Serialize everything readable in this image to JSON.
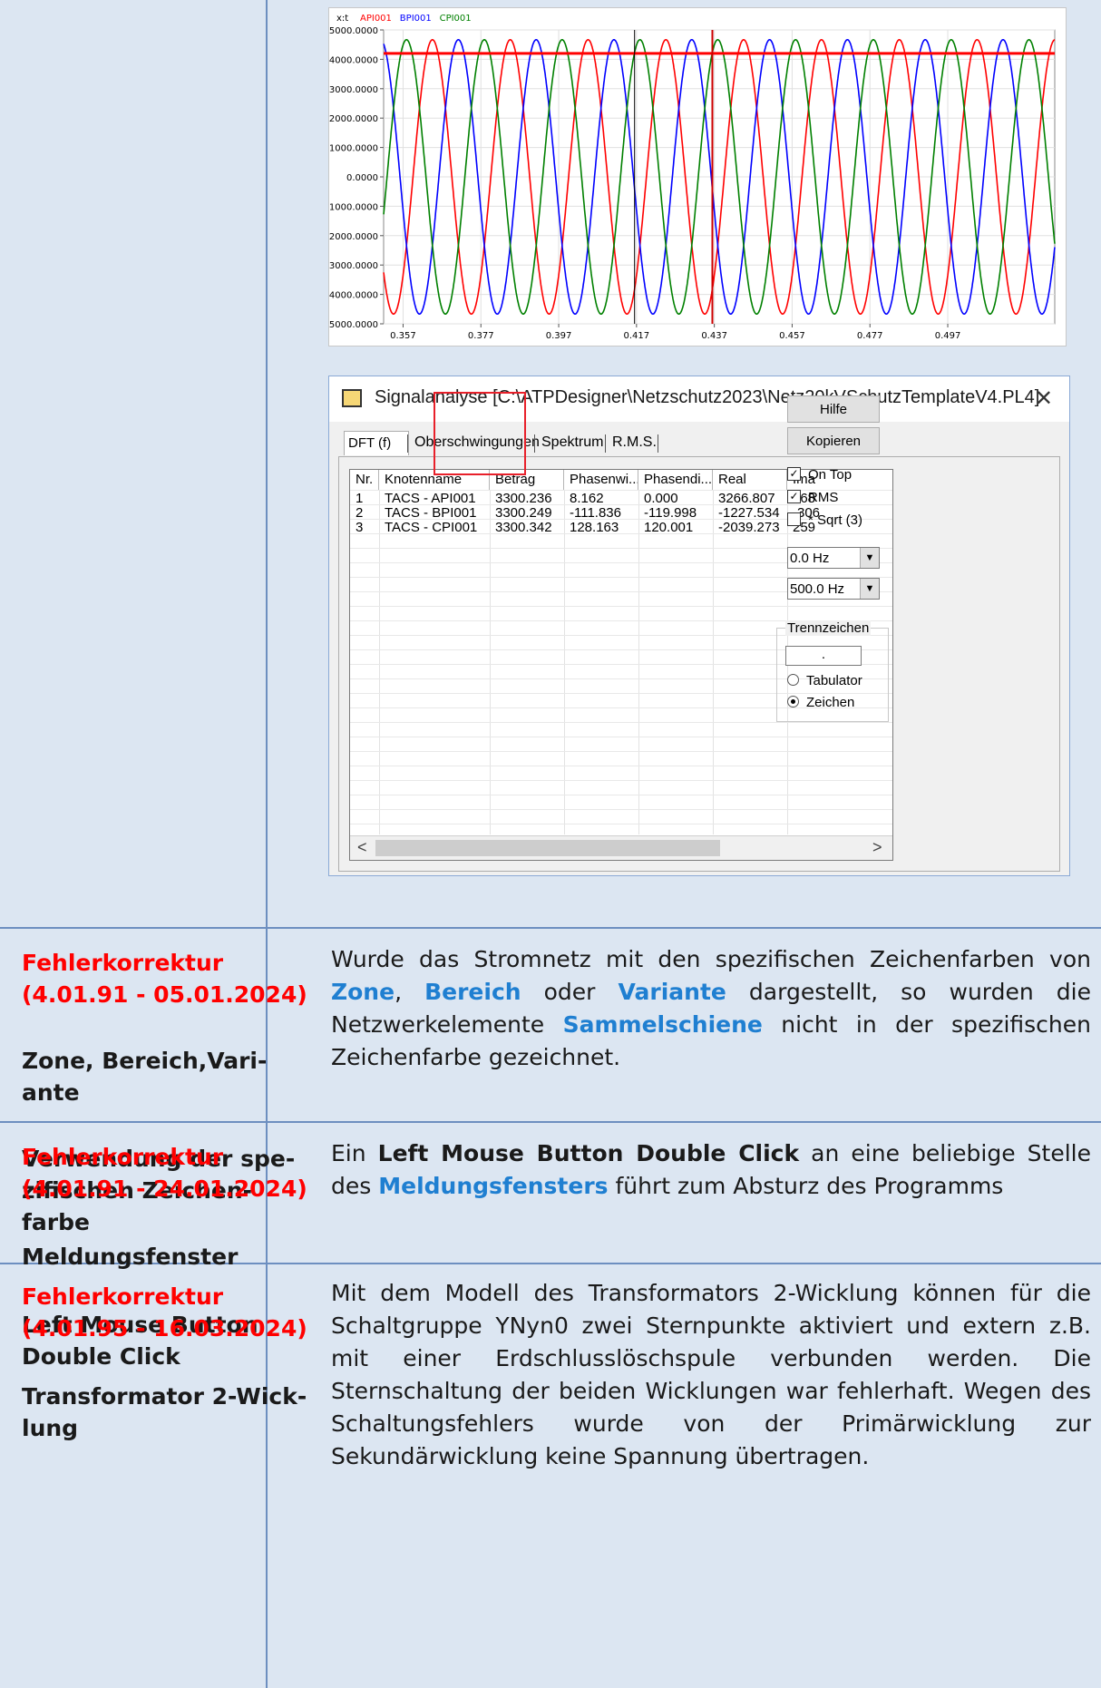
{
  "chart_data": {
    "type": "line",
    "legend_prefix": "x:t",
    "series": [
      {
        "name": "API001",
        "color": "#ff0000",
        "phase_deg": 8.162,
        "amplitude": 4667
      },
      {
        "name": "BPI001",
        "color": "#0000ff",
        "phase_deg": -111.836,
        "amplitude": 4667
      },
      {
        "name": "CPI001",
        "color": "#008000",
        "phase_deg": 128.163,
        "amplitude": 4667
      }
    ],
    "frequency_hz": 50,
    "x_ticks": [
      "0.357",
      "0.377",
      "0.397",
      "0.417",
      "0.437",
      "0.457",
      "0.477",
      "0.497"
    ],
    "y_ticks": [
      "5000.0000",
      "4000.0000",
      "3000.0000",
      "2000.0000",
      "1000.0000",
      "0.0000",
      "-1000.0000",
      "-2000.0000",
      "-3000.0000",
      "-4000.0000",
      "-5000.0000"
    ],
    "xlim": [
      0.352,
      0.5245
    ],
    "ylim": [
      -5000,
      5000
    ],
    "horizontal_marker_y": 4200,
    "cursor_x": [
      0.4165,
      0.4365
    ],
    "grid": true
  },
  "dialog": {
    "title": "Signalanalyse [C:\\ATPDesigner\\Netzschutz2023\\Netz20kVSchutzTemplateV4.PL4]",
    "close_label": "✕",
    "tabs": [
      "DFT (f)",
      "Oberschwingungen",
      "Spektrum",
      "R.M.S."
    ],
    "columns": [
      "Nr.",
      "Knotenname",
      "Betrag",
      "Phasenwi...",
      "Phasendi...",
      "Real",
      "Ima"
    ],
    "rows": [
      [
        "1",
        "TACS - API001",
        "3300.236",
        "8.162",
        "0.000",
        "3266.807",
        "468"
      ],
      [
        "2",
        "TACS - BPI001",
        "3300.249",
        "-111.836",
        "-119.998",
        "-1227.534",
        "-306"
      ],
      [
        "3",
        "TACS - CPI001",
        "3300.342",
        "128.163",
        "120.001",
        "-2039.273",
        "259"
      ]
    ],
    "buttons": {
      "help": "Hilfe",
      "copy": "Kopieren"
    },
    "checks": {
      "on_top": "On Top",
      "rms": "RMS",
      "sqrt3": "* Sqrt (3)"
    },
    "freq_from": "0.0 Hz",
    "freq_to": "500.0 Hz",
    "separator_group": "Trennzeichen",
    "separator_value": ".",
    "radio_tab": "Tabulator",
    "radio_char": "Zeichen",
    "scroll_left": "<",
    "scroll_right": ">"
  },
  "rows": [
    {
      "left": {
        "fix_label": "Fehlerkorrektur",
        "version": "(4.01.91 - 05.01.2024)",
        "topic_l1": "Zone, Bereich,Vari-",
        "topic_l2": "ante",
        "sub_l1": "Verwendung der spe-",
        "sub_l2": "zifischen Zeichen-",
        "sub_l3": "farbe"
      },
      "right": {
        "t1": "Wurde das Stromnetz mit den spezifischen Zeichenfarben von ",
        "k1": "Zone",
        "t2": ", ",
        "k2": "Bereich",
        "t3": " oder ",
        "k3": "Variante",
        "t4": " dargestellt, so wurden die Netzwerkelemente ",
        "k4": "Sammelschiene",
        "t5": " nicht in der spezifischen Zeichenfarbe gezeichnet."
      }
    },
    {
      "left": {
        "fix_label": "Fehlerkorrektur",
        "version": "(4.01.91 - 24.01.2024)",
        "topic_l1": "Meldungsfenster",
        "sub_l1": "Left Mouse Button",
        "sub_l2": "Double Click"
      },
      "right": {
        "t1": "Ein ",
        "s1": "Left Mouse Button Double Click",
        "t2": " an eine beliebige Stelle des ",
        "k1": "Meldungsfensters",
        "t3": " führt zum Absturz des Programms"
      }
    },
    {
      "left": {
        "fix_label": "Fehlerkorrektur",
        "version": "(4.01.95 - 16.03.2024)",
        "topic_l1": "Transformator 2-Wick-",
        "topic_l2": "lung"
      },
      "right": {
        "text": "Mit dem Modell des Transformators 2-Wicklung können für die Schaltgruppe YNyn0 zwei Sternpunkte aktiviert und extern z.B. mit einer Erdschlusslöschspule verbunden werden. Die Sternschaltung der beiden Wicklungen war fehlerhaft. Wegen des Schaltungsfehlers wurde von der Primärwicklung zur Sekundärwicklung keine Spannung übertragen."
      }
    }
  ]
}
